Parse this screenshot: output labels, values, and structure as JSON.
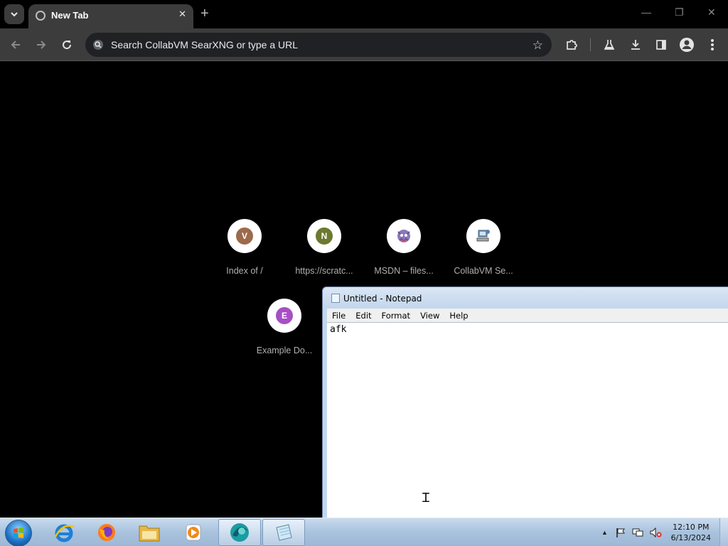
{
  "browser": {
    "tab_title": "New Tab",
    "omnibox_placeholder": "Search CollabVM SearXNG or type a URL",
    "shortcuts": [
      {
        "letter": "V",
        "label": "Index of /",
        "color": "#9c6a4c"
      },
      {
        "letter": "N",
        "label": "https://scratc...",
        "color": "#6b7a2e"
      },
      {
        "letter": "",
        "label": "MSDN – files...",
        "icon": "msdn-icon"
      },
      {
        "letter": "",
        "label": "CollabVM Se...",
        "icon": "computer-icon"
      },
      {
        "letter": "E",
        "label": "Example Do...",
        "color": "#a64fc4"
      }
    ]
  },
  "notepad": {
    "title": "Untitled - Notepad",
    "menu": [
      "File",
      "Edit",
      "Format",
      "View",
      "Help"
    ],
    "content": "afk"
  },
  "taskbar": {
    "clock_time": "12:10 PM",
    "clock_date": "6/13/2024",
    "pinned": [
      "internet-explorer-icon",
      "firefox-icon",
      "file-explorer-icon",
      "media-player-icon",
      "browser-icon",
      "notepad-icon"
    ]
  }
}
